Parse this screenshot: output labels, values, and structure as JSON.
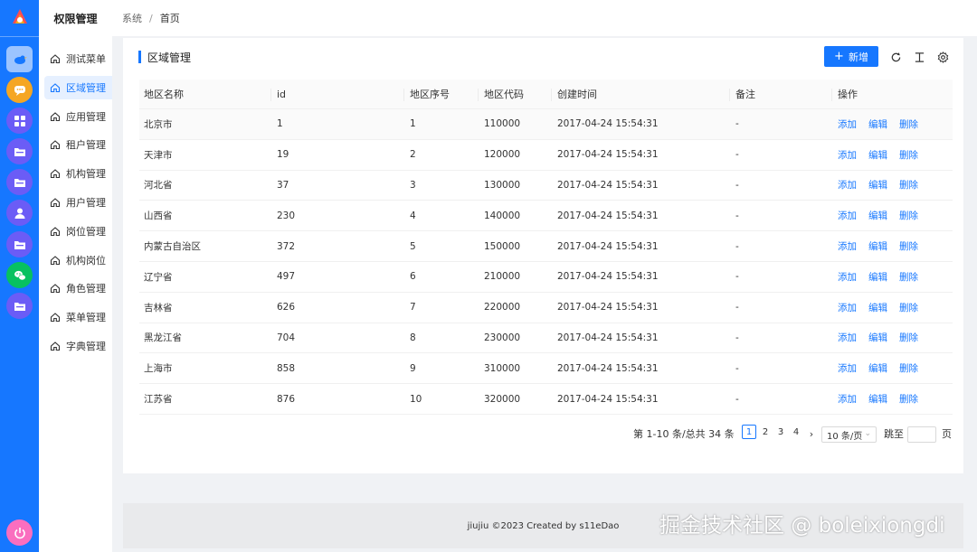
{
  "sidebar": {
    "title": "权限管理",
    "items": [
      {
        "label": "测试菜单",
        "active": false
      },
      {
        "label": "区域管理",
        "active": true
      },
      {
        "label": "应用管理",
        "active": false
      },
      {
        "label": "租户管理",
        "active": false
      },
      {
        "label": "机构管理",
        "active": false
      },
      {
        "label": "用户管理",
        "active": false
      },
      {
        "label": "岗位管理",
        "active": false
      },
      {
        "label": "机构岗位",
        "active": false
      },
      {
        "label": "角色管理",
        "active": false
      },
      {
        "label": "菜单管理",
        "active": false
      },
      {
        "label": "字典管理",
        "active": false
      }
    ]
  },
  "rail": {
    "apps": [
      {
        "icon": "bird-icon",
        "color": "#9cc4ff"
      },
      {
        "icon": "chat-icon",
        "color": "#f5a623"
      },
      {
        "icon": "grid-icon",
        "color": "#6b5cf6"
      },
      {
        "icon": "folder-icon",
        "color": "#6b5cf6"
      },
      {
        "icon": "folder-icon",
        "color": "#6b5cf6"
      },
      {
        "icon": "user-icon",
        "color": "#6b5cf6"
      },
      {
        "icon": "folder-icon",
        "color": "#6b5cf6"
      },
      {
        "icon": "wechat-icon",
        "color": "#07c160"
      },
      {
        "icon": "folder-icon",
        "color": "#6b5cf6"
      }
    ],
    "power_color": "#fa6ebf"
  },
  "breadcrumb": {
    "root": "系统",
    "separator": "/",
    "current": "首页"
  },
  "card": {
    "title": "区域管理",
    "add_label": "新增",
    "columns": [
      "地区名称",
      "id",
      "地区序号",
      "地区代码",
      "创建时间",
      "备注",
      "操作"
    ],
    "rows": [
      {
        "name": "北京市",
        "id": "1",
        "seq": "1",
        "code": "110000",
        "created": "2017-04-24 15:54:31",
        "remark": "-"
      },
      {
        "name": "天津市",
        "id": "19",
        "seq": "2",
        "code": "120000",
        "created": "2017-04-24 15:54:31",
        "remark": "-"
      },
      {
        "name": "河北省",
        "id": "37",
        "seq": "3",
        "code": "130000",
        "created": "2017-04-24 15:54:31",
        "remark": "-"
      },
      {
        "name": "山西省",
        "id": "230",
        "seq": "4",
        "code": "140000",
        "created": "2017-04-24 15:54:31",
        "remark": "-"
      },
      {
        "name": "内蒙古自治区",
        "id": "372",
        "seq": "5",
        "code": "150000",
        "created": "2017-04-24 15:54:31",
        "remark": "-"
      },
      {
        "name": "辽宁省",
        "id": "497",
        "seq": "6",
        "code": "210000",
        "created": "2017-04-24 15:54:31",
        "remark": "-"
      },
      {
        "name": "吉林省",
        "id": "626",
        "seq": "7",
        "code": "220000",
        "created": "2017-04-24 15:54:31",
        "remark": "-"
      },
      {
        "name": "黑龙江省",
        "id": "704",
        "seq": "8",
        "code": "230000",
        "created": "2017-04-24 15:54:31",
        "remark": "-"
      },
      {
        "name": "上海市",
        "id": "858",
        "seq": "9",
        "code": "310000",
        "created": "2017-04-24 15:54:31",
        "remark": "-"
      },
      {
        "name": "江苏省",
        "id": "876",
        "seq": "10",
        "code": "320000",
        "created": "2017-04-24 15:54:31",
        "remark": "-"
      }
    ],
    "actions": [
      "添加",
      "编辑",
      "删除"
    ]
  },
  "pagination": {
    "total_text": "第 1-10 条/总共 34 条",
    "pages": [
      "1",
      "2",
      "3",
      "4"
    ],
    "current": "1",
    "prev": "‹",
    "next": "›",
    "page_size": "10 条/页",
    "jump_label": "跳至",
    "page_label": "页"
  },
  "footer": {
    "text": "jiujiu ©2023 Created by s11eDao"
  },
  "watermark": "掘金技术社区 @ boleixiongdi",
  "colors": {
    "primary": "#1677ff",
    "rail": "#1677ff"
  }
}
